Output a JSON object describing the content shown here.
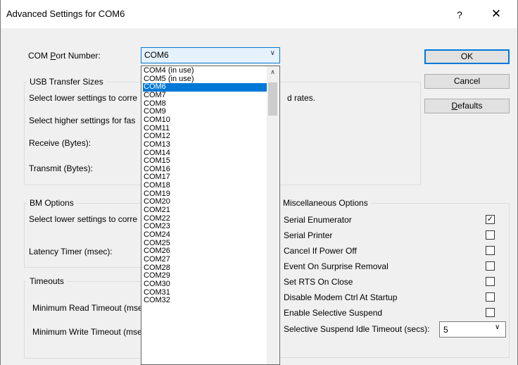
{
  "window": {
    "title": "Advanced Settings for COM6",
    "help_label": "?",
    "close_label": "✕"
  },
  "com_port": {
    "label_pre": "COM ",
    "label_acc": "P",
    "label_post": "ort Number:",
    "selected": "COM6",
    "arrow": "∨"
  },
  "buttons": {
    "ok": "OK",
    "cancel": "Cancel",
    "defaults_acc": "D",
    "defaults_rest": "efaults"
  },
  "usb_transfer": {
    "title": "USB Transfer Sizes",
    "line1": "Select lower settings to corre",
    "line1_tail": "d rates.",
    "line2": "Select higher settings for fas",
    "receive_label": "Receive (Bytes):",
    "transmit_label": "Transmit (Bytes):"
  },
  "bm_options": {
    "title": "BM Options",
    "line1": "Select lower settings to corre",
    "latency_label": "Latency Timer (msec):"
  },
  "timeouts": {
    "title": "Timeouts",
    "read_label": "Minimum Read Timeout (mse",
    "write_label": "Minimum Write Timeout (mse"
  },
  "misc": {
    "title": "Miscellaneous Options",
    "options": [
      {
        "label": "Serial Enumerator",
        "checked": true
      },
      {
        "label": "Serial Printer",
        "checked": false
      },
      {
        "label": "Cancel If Power Off",
        "checked": false
      },
      {
        "label": "Event On Surprise Removal",
        "checked": false
      },
      {
        "label": "Set RTS On Close",
        "checked": false
      },
      {
        "label": "Disable Modem Ctrl At Startup",
        "checked": false
      },
      {
        "label": "Enable Selective Suspend",
        "checked": false
      }
    ],
    "suspend_timeout_label": "Selective Suspend Idle Timeout (secs):",
    "suspend_timeout_value": "5",
    "suspend_timeout_arrow": "∨"
  },
  "dropdown": {
    "scroll_up": "∧",
    "items": [
      "COM4 (in use)",
      "COM5 (in use)",
      "COM6",
      "COM7",
      "COM8",
      "COM9",
      "COM10",
      "COM11",
      "COM12",
      "COM13",
      "COM14",
      "COM15",
      "COM16",
      "COM17",
      "COM18",
      "COM19",
      "COM20",
      "COM21",
      "COM22",
      "COM23",
      "COM24",
      "COM25",
      "COM26",
      "COM27",
      "COM28",
      "COM29",
      "COM30",
      "COM31",
      "COM32"
    ],
    "selected_index": 2
  },
  "colors": {
    "accent": "#0078d7",
    "dialog_bg": "#f0f0f0"
  }
}
